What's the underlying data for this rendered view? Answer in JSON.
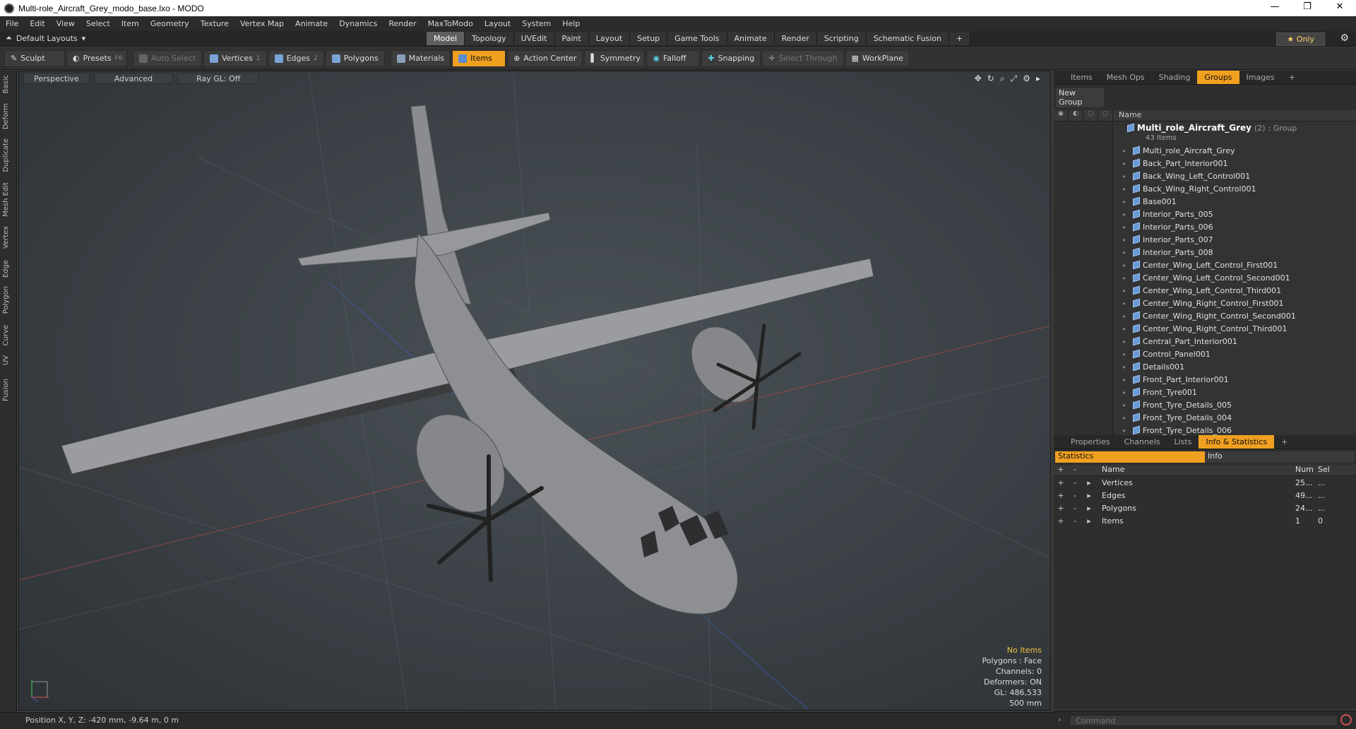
{
  "window": {
    "title": "Multi-role_Aircraft_Grey_modo_base.lxo - MODO",
    "controls": [
      "—",
      "❐",
      "✕"
    ]
  },
  "menu": [
    "File",
    "Edit",
    "View",
    "Select",
    "Item",
    "Geometry",
    "Texture",
    "Vertex Map",
    "Animate",
    "Dynamics",
    "Render",
    "MaxToModo",
    "Layout",
    "System",
    "Help"
  ],
  "layout": {
    "current": "Default Layouts",
    "tabs": [
      "Model",
      "Topology",
      "UVEdit",
      "Paint",
      "Layout",
      "Setup",
      "Game Tools",
      "Animate",
      "Render",
      "Scripting",
      "Schematic Fusion"
    ],
    "active_tab": "Model",
    "only_label": "Only"
  },
  "toolbar": {
    "sculpt": "Sculpt",
    "presets": "Presets",
    "presets_key": "F6",
    "auto_select": "Auto Select",
    "vertices": "Vertices",
    "vertices_key": "1",
    "edges": "Edges",
    "edges_key": "2",
    "polygons": "Polygons",
    "materials": "Materials",
    "items": "Items",
    "action_center": "Action Center",
    "symmetry": "Symmetry",
    "falloff": "Falloff",
    "snapping": "Snapping",
    "select_through": "Select Through",
    "workplane": "WorkPlane"
  },
  "left_tabs": [
    "Basic",
    "Deform",
    "Duplicate",
    "Mesh Edit",
    "Vertex",
    "Edge",
    "Polygon",
    "Curve",
    "UV",
    "Fusion"
  ],
  "viewport": {
    "view": "Perspective",
    "mode": "Advanced",
    "raygl": "Ray GL: Off",
    "info": {
      "selection": "No Items",
      "polygons": "Polygons : Face",
      "channels": "Channels: 0",
      "deformers": "Deformers: ON",
      "gl": "GL: 486,533",
      "scale": "500 mm"
    }
  },
  "status": {
    "position": "Position X, Y, Z:  -420 mm, -9.64 m, 0 m"
  },
  "items_panel": {
    "tabs": [
      "Items",
      "Mesh Ops",
      "Shading",
      "Groups",
      "Images"
    ],
    "active_tab": "Groups",
    "new_group": "New Group",
    "col_name": "Name",
    "group_name": "Multi_role_Aircraft_Grey",
    "group_count": "(2)",
    "group_type": ": Group",
    "group_items": "43 Items",
    "rows": [
      "Multi_role_Aircraft_Grey",
      "Back_Part_Interior001",
      "Back_Wing_Left_Control001",
      "Back_Wing_Right_Control001",
      "Base001",
      "Interior_Parts_005",
      "Interior_Parts_006",
      "Interior_Parts_007",
      "Interior_Parts_008",
      "Center_Wing_Left_Control_First001",
      "Center_Wing_Left_Control_Second001",
      "Center_Wing_Left_Control_Third001",
      "Center_Wing_Right_Control_First001",
      "Center_Wing_Right_Control_Second001",
      "Center_Wing_Right_Control_Third001",
      "Central_Part_Interior001",
      "Control_Panel001",
      "Details001",
      "Front_Part_Interior001",
      "Front_Tyre001",
      "Front_Tyre_Details_005",
      "Front_Tyre_Details_004",
      "Front_Tyre_Details_006"
    ]
  },
  "stats_panel": {
    "tabs": [
      "Properties",
      "Channels",
      "Lists",
      "Info & Statistics"
    ],
    "active_tab": "Info & Statistics",
    "sub_tabs": [
      "Statistics",
      "Info"
    ],
    "col_name": "Name",
    "col_num": "Num",
    "col_sel": "Sel",
    "rows": [
      {
        "name": "Vertices",
        "num": "25...",
        "sel": "..."
      },
      {
        "name": "Edges",
        "num": "49...",
        "sel": "..."
      },
      {
        "name": "Polygons",
        "num": "24...",
        "sel": "..."
      },
      {
        "name": "Items",
        "num": "1",
        "sel": "0"
      }
    ]
  },
  "command": {
    "placeholder": "Command"
  },
  "colors": {
    "accent": "#f0a020",
    "background": "#2e2e2e",
    "viewport": "#3f4549",
    "aircraft": "#8d8f92"
  }
}
